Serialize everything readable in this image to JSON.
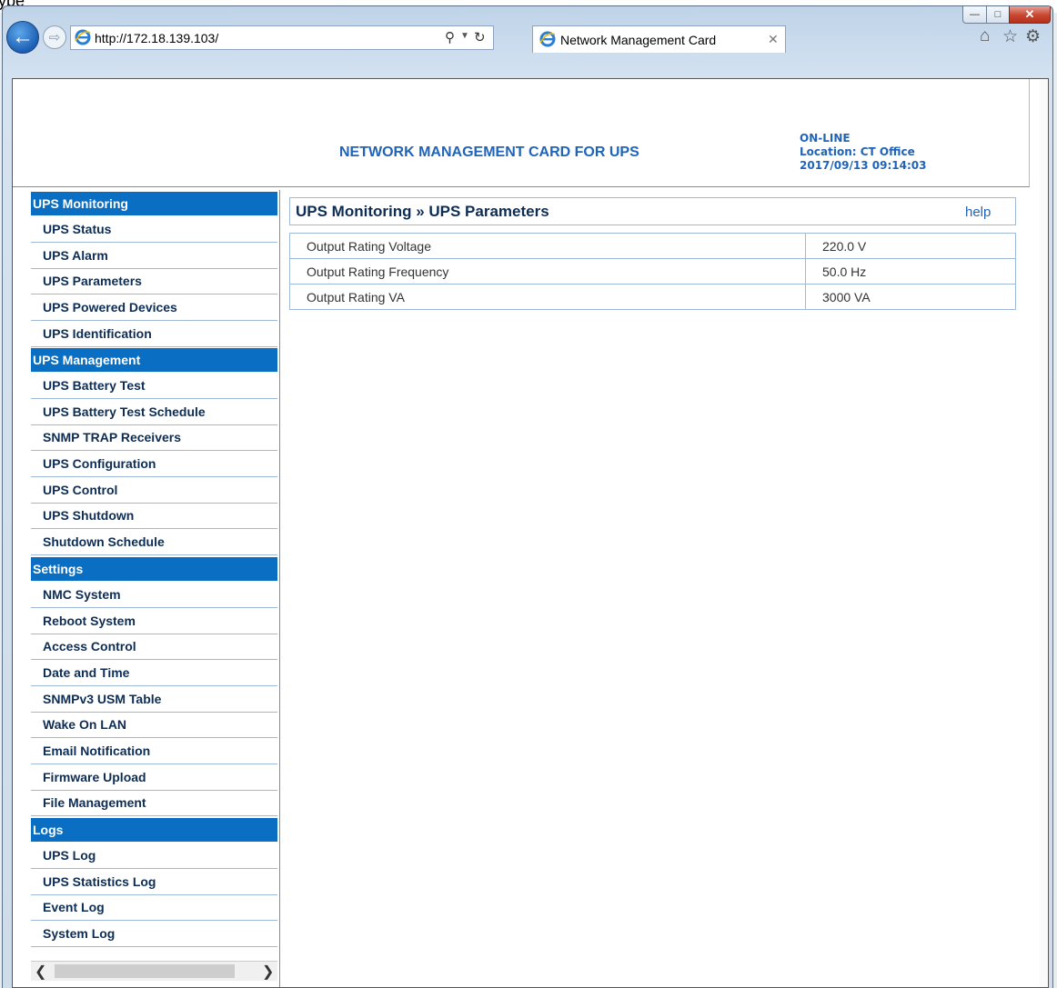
{
  "browser": {
    "url_prefix": "http://",
    "url_host": "172.18.139.103",
    "url_suffix": "/",
    "tab_title": "Network Management Card",
    "background_hint": "ype"
  },
  "header": {
    "title": "NETWORK MANAGEMENT CARD FOR UPS",
    "status": "ON-LINE",
    "location": "Location: CT Office",
    "datetime": "2017/09/13 09:14:03"
  },
  "menu": {
    "sections": [
      {
        "label": "UPS Monitoring",
        "items": [
          "UPS Status",
          "UPS Alarm",
          "UPS Parameters",
          "UPS Powered Devices",
          "UPS Identification"
        ]
      },
      {
        "label": "UPS Management",
        "items": [
          "UPS Battery Test",
          "UPS Battery Test Schedule",
          "SNMP TRAP Receivers",
          "UPS Configuration",
          "UPS Control",
          "UPS Shutdown",
          "Shutdown Schedule"
        ]
      },
      {
        "label": "Settings",
        "items": [
          "NMC System",
          "Reboot System",
          "Access Control",
          "Date and Time",
          "SNMPv3 USM Table",
          "Wake On LAN",
          "Email Notification",
          "Firmware Upload",
          "File Management"
        ]
      },
      {
        "label": "Logs",
        "items": [
          "UPS Log",
          "UPS Statistics Log",
          "Event Log",
          "System Log"
        ]
      }
    ]
  },
  "main": {
    "breadcrumb": "UPS Monitoring » UPS Parameters",
    "help_label": "help",
    "parameters": [
      {
        "name": "Output Rating Voltage",
        "value": "220.0 V"
      },
      {
        "name": "Output Rating Frequency",
        "value": "50.0 Hz"
      },
      {
        "name": "Output Rating VA",
        "value": "3000 VA"
      }
    ]
  },
  "colors": {
    "menu_section_bg": "#0a6fc2",
    "header_text": "#1f64b8",
    "link_dark": "#0d2d55"
  }
}
